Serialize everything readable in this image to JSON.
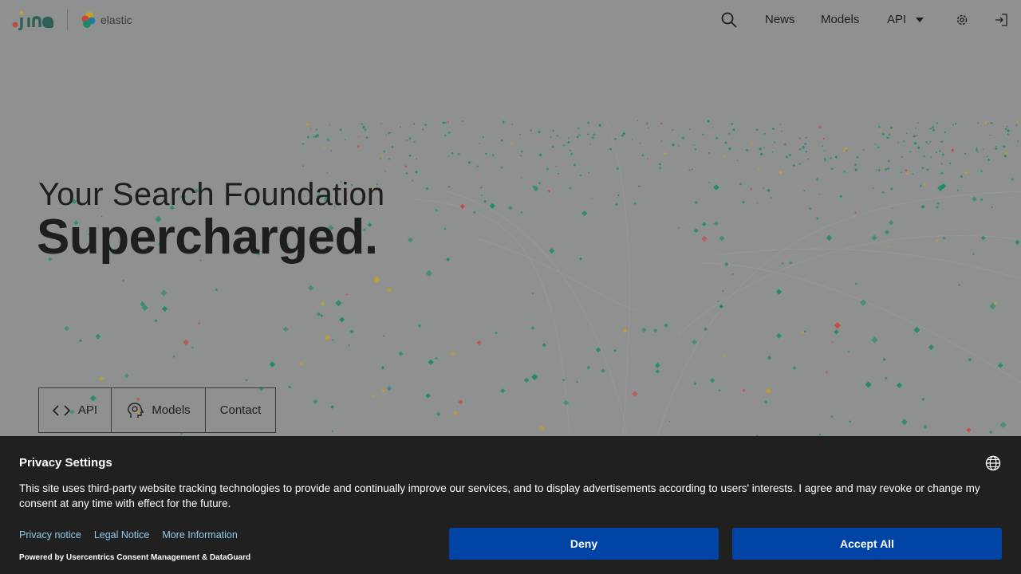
{
  "header": {
    "brand_elastic": "elastic",
    "nav": {
      "news": "News",
      "models": "Models",
      "api": "API"
    },
    "icons": [
      "search-icon",
      "chevron-down-icon",
      "gear-icon",
      "login-icon"
    ]
  },
  "hero": {
    "line1": "Your Search Foundation",
    "line2": "Supercharged.",
    "buttons": {
      "api": "API",
      "models": "Models",
      "contact": "Contact"
    }
  },
  "consent": {
    "title": "Privacy Settings",
    "text": "This site uses third-party website tracking technologies to provide and continually improve our services, and to display advertisements according to users' interests. I agree and may revoke or change my consent at any time with effect for the future.",
    "links": {
      "privacy": "Privacy notice",
      "legal": "Legal Notice",
      "more": "More Information"
    },
    "powered": "Powered by Usercentrics Consent Management & DataGuard",
    "deny": "Deny",
    "accept": "Accept All"
  },
  "colors": {
    "page_overlay": "#8e9190",
    "banner_bg": "#202021",
    "button_blue": "#0045a5",
    "link_blue": "#8ecdf0",
    "particle_green": "#1a8a6a",
    "particle_yellow": "#c9a018",
    "particle_red": "#d0433a"
  }
}
